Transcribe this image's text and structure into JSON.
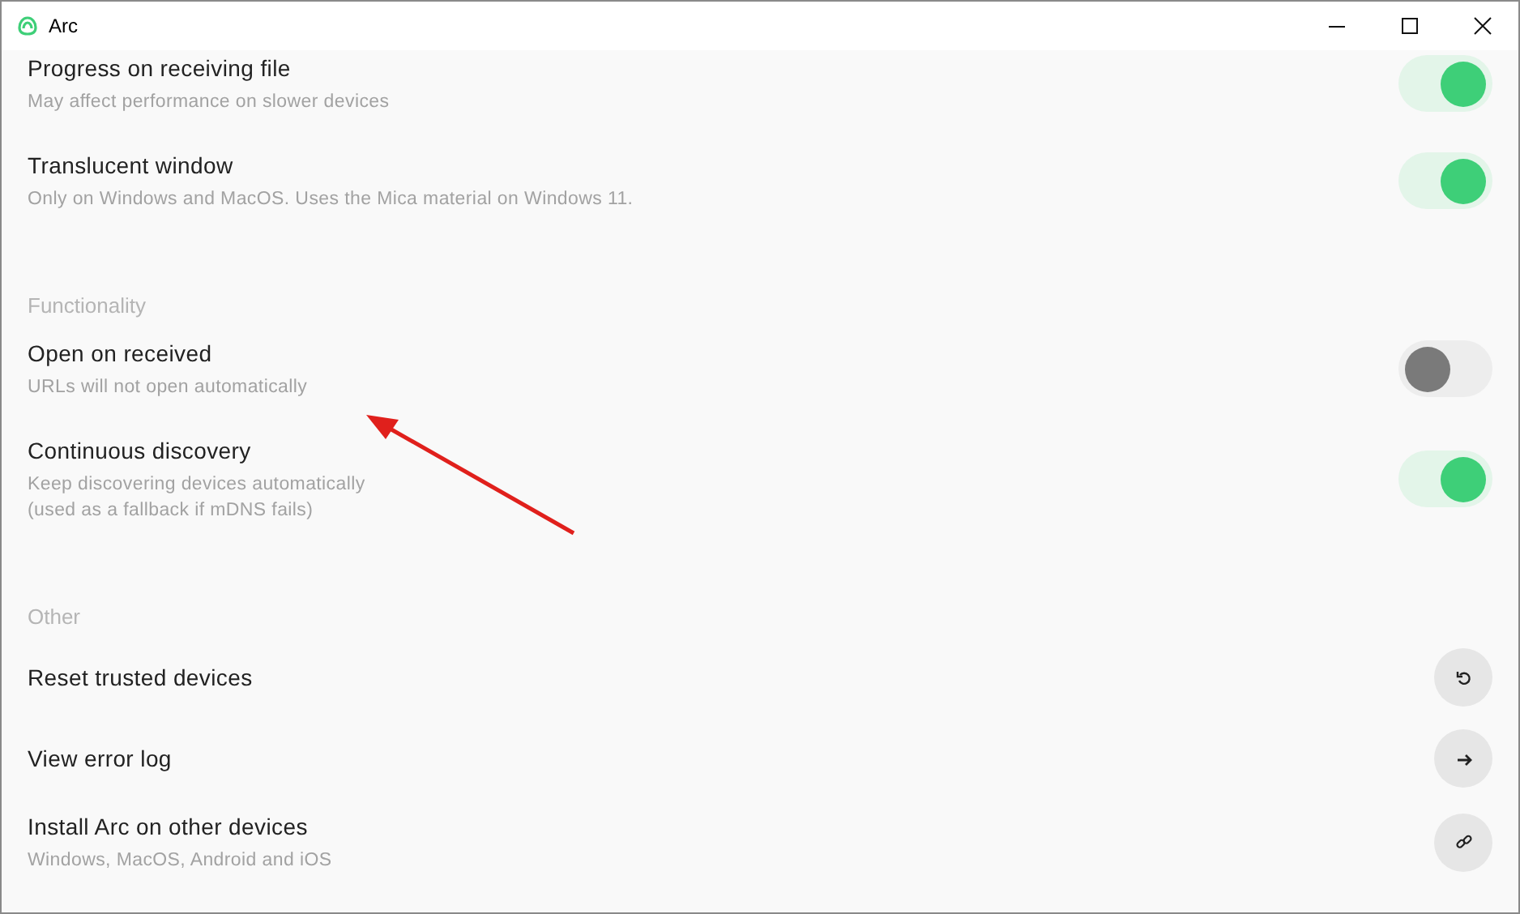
{
  "window": {
    "title": "Arc"
  },
  "sections": [
    {
      "items": [
        {
          "kind": "toggle",
          "title": "Progress on receiving file",
          "description": [
            "May affect performance on slower devices"
          ],
          "on": true
        },
        {
          "kind": "toggle",
          "title": "Translucent window",
          "description": [
            "Only on Windows and MacOS. Uses the Mica material on Windows 11."
          ],
          "on": true
        }
      ]
    },
    {
      "header": "Functionality",
      "items": [
        {
          "kind": "toggle",
          "title": "Open on received",
          "description": [
            "URLs will not open automatically"
          ],
          "on": false
        },
        {
          "kind": "toggle",
          "title": "Continuous discovery",
          "description": [
            "Keep discovering devices automatically",
            "(used as a fallback if mDNS fails)"
          ],
          "on": true
        }
      ]
    },
    {
      "header": "Other",
      "items": [
        {
          "kind": "reset",
          "title": "Reset trusted devices"
        },
        {
          "kind": "forward",
          "title": "View error log"
        },
        {
          "kind": "link",
          "title": "Install Arc on other devices",
          "description": [
            "Windows, MacOS, Android and iOS"
          ]
        }
      ]
    }
  ]
}
